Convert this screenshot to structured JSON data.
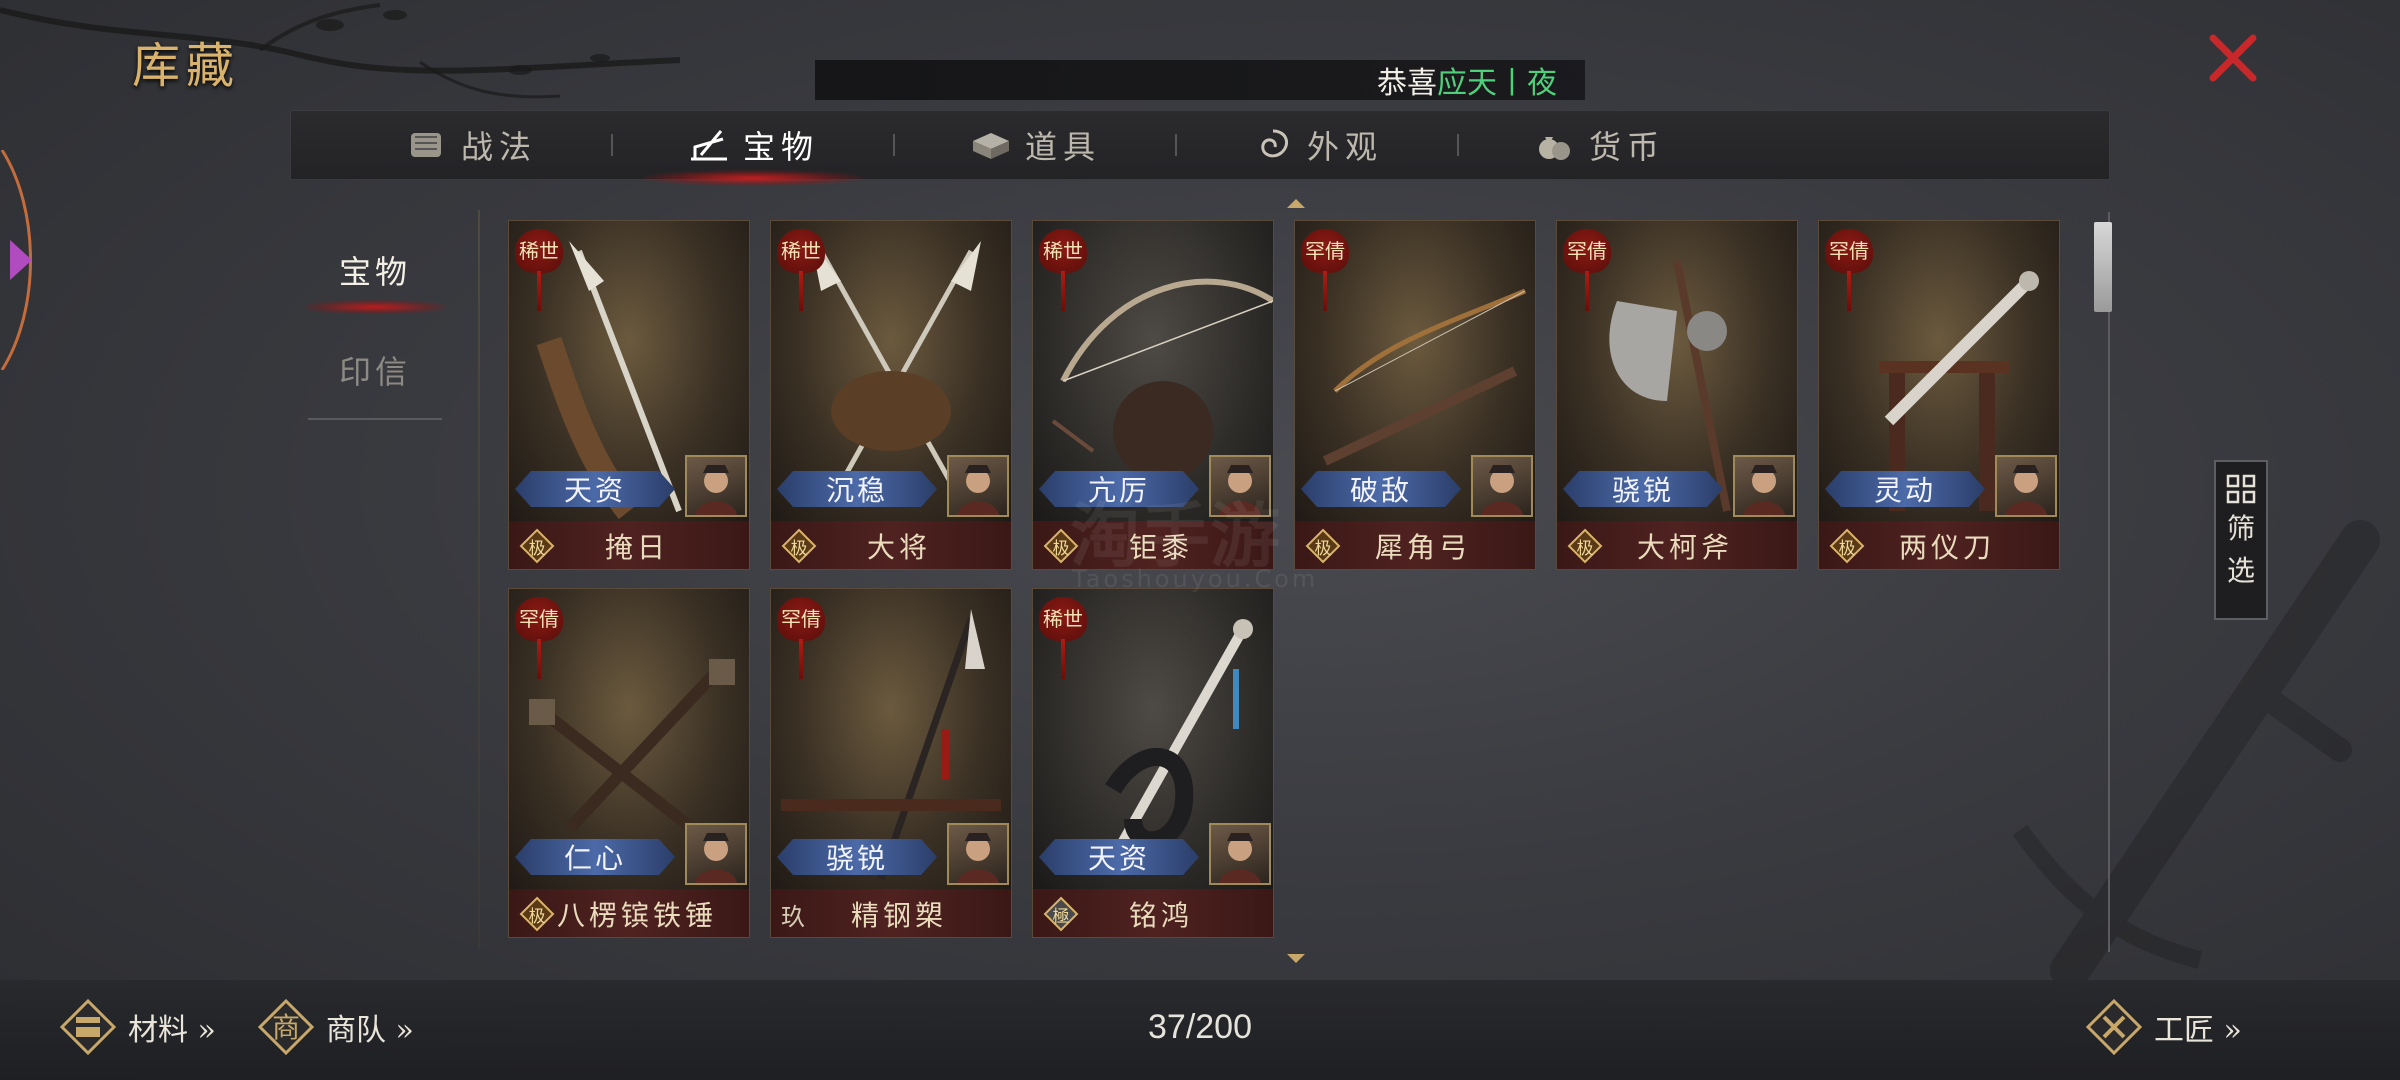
{
  "header": {
    "title": "库藏",
    "announcement": {
      "prefix": "恭喜",
      "name": "应天丨夜",
      "tail": ""
    }
  },
  "tabs": [
    {
      "label": "战法",
      "icon": "scroll-icon",
      "active": false
    },
    {
      "label": "宝物",
      "icon": "treasure-icon",
      "active": true
    },
    {
      "label": "道具",
      "icon": "box-icon",
      "active": false
    },
    {
      "label": "外观",
      "icon": "swirl-icon",
      "active": false
    },
    {
      "label": "货币",
      "icon": "coin-bag-icon",
      "active": false
    }
  ],
  "side_nav": [
    {
      "label": "宝物",
      "active": true
    },
    {
      "label": "印信",
      "active": false
    }
  ],
  "cards": [
    {
      "rarity": "稀世",
      "trait": "天资",
      "grade": "极",
      "name": "掩日",
      "weapon": "glaive"
    },
    {
      "rarity": "稀世",
      "trait": "沉稳",
      "grade": "极",
      "name": "大将",
      "weapon": "crossed-halberds"
    },
    {
      "rarity": "稀世",
      "trait": "亢厉",
      "grade": "极",
      "name": "钜黍",
      "weapon": "bow"
    },
    {
      "rarity": "罕倩",
      "trait": "破敌",
      "grade": "极",
      "name": "犀角弓",
      "weapon": "crossbow"
    },
    {
      "rarity": "罕倩",
      "trait": "骁锐",
      "grade": "极",
      "name": "大柯斧",
      "weapon": "axe"
    },
    {
      "rarity": "罕倩",
      "trait": "灵动",
      "grade": "极",
      "name": "两仪刀",
      "weapon": "blade-on-rack"
    },
    {
      "rarity": "罕倩",
      "trait": "仁心",
      "grade": "极",
      "name": "八楞镔铁锤",
      "weapon": "crossed-maces"
    },
    {
      "rarity": "罕倩",
      "trait": "骁锐",
      "grade": "玖",
      "name": "精钢槊",
      "weapon": "spear"
    },
    {
      "rarity": "稀世",
      "trait": "天资",
      "grade": "極",
      "name": "铭鸿",
      "weapon": "dragon-sword"
    }
  ],
  "watermark": {
    "main": "淘手游",
    "sub": "Taoshouyou.Com"
  },
  "filter": {
    "label_1": "筛",
    "label_2": "选"
  },
  "bottom": {
    "materials": "材料 »",
    "caravan": "商队 »",
    "counter": "37/200",
    "craftsman": "工匠 »"
  },
  "colors": {
    "accent_gold": "#d9b36b",
    "close_red": "#c8282a",
    "announce_green": "#4fd07a",
    "trait_blue": "#4c6aa8"
  }
}
